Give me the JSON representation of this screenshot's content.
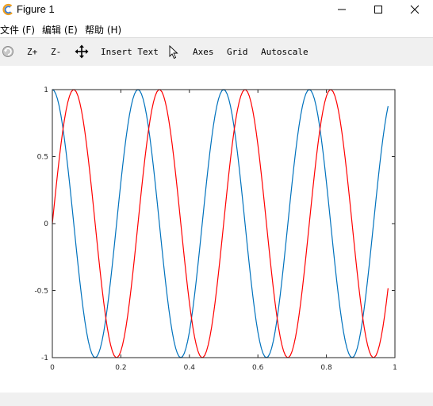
{
  "window": {
    "title": "Figure 1"
  },
  "menu": {
    "items": [
      {
        "label": "文件 (F)",
        "accel": "F"
      },
      {
        "label": "编辑 (E)",
        "accel": "E"
      },
      {
        "label": "帮助 (H)",
        "accel": "H"
      }
    ]
  },
  "toolbar": {
    "rotate_icon": "rotate-icon",
    "zoom_in_label": "Z+",
    "zoom_out_label": "Z-",
    "pan_icon": "pan-arrows-icon",
    "insert_text_label": "Insert Text",
    "select_icon": "cursor-arrow-icon",
    "axes_label": "Axes",
    "grid_label": "Grid",
    "autoscale_label": "Autoscale"
  },
  "chart_data": {
    "type": "line",
    "title": "",
    "xlabel": "",
    "ylabel": "",
    "xlim": [
      0,
      1
    ],
    "ylim": [
      -1,
      1
    ],
    "xticks": [
      "0",
      "0.2",
      "0.4",
      "0.6",
      "0.8",
      "1"
    ],
    "yticks": [
      "1",
      "0.5",
      "0",
      "-0.5",
      "-1"
    ],
    "grid": false,
    "legend": "none",
    "x": {
      "start": 0,
      "end": 0.98,
      "step": 0.005
    },
    "series": [
      {
        "function": "cos(2*pi*4*x)",
        "color": "#0072bd"
      },
      {
        "function": "sin(2*pi*4*x)",
        "color": "#ff0000"
      }
    ]
  }
}
